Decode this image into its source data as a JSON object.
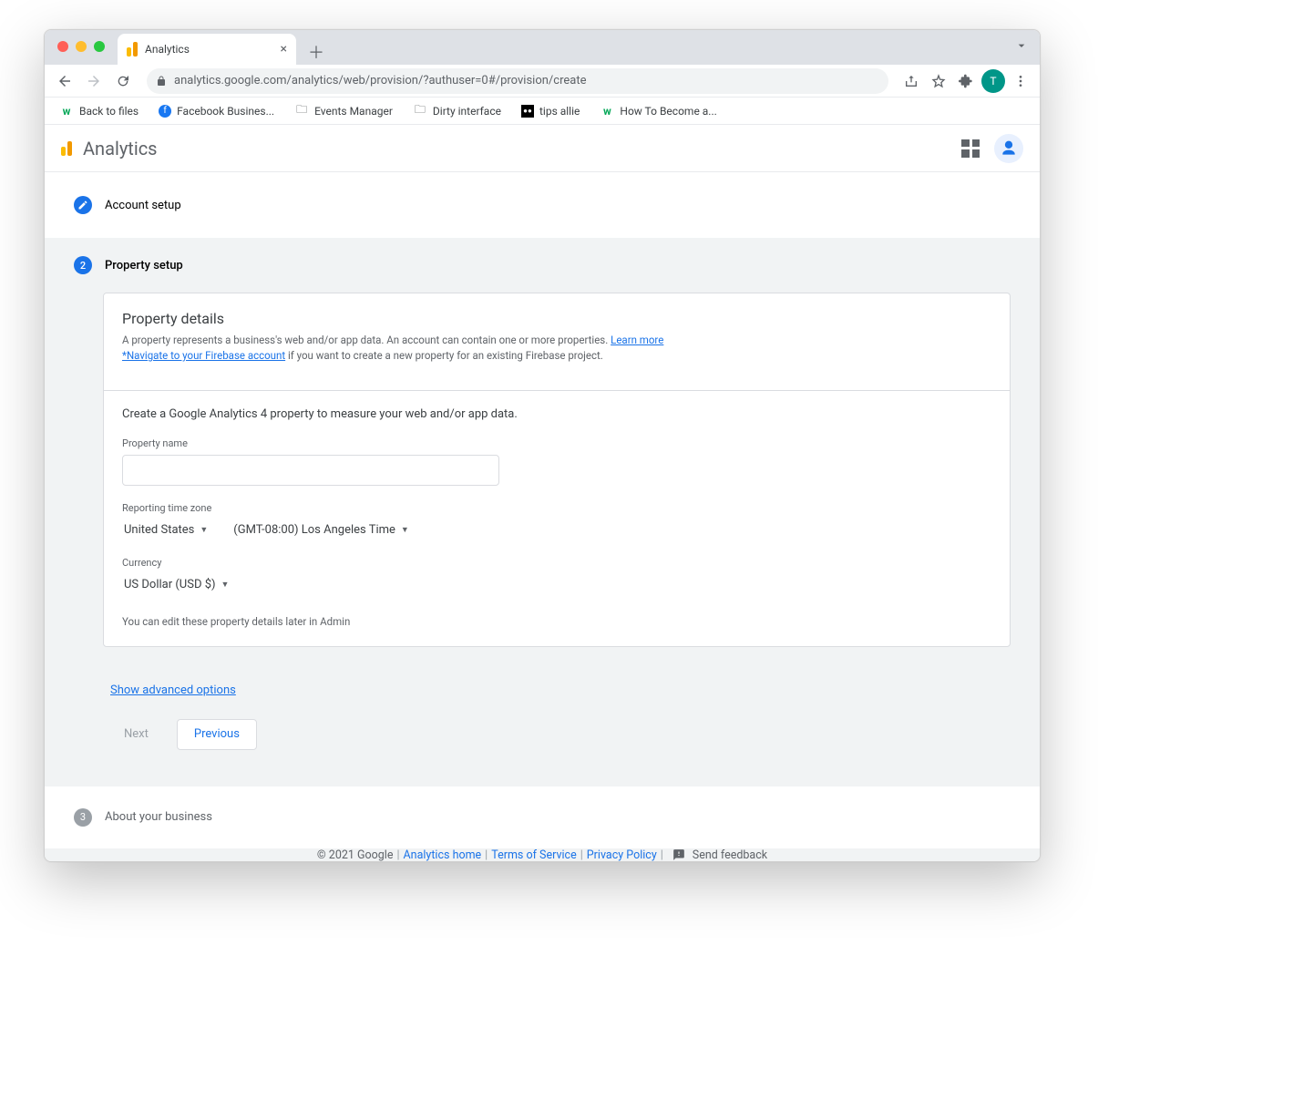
{
  "browser": {
    "tab_title": "Analytics",
    "url": "analytics.google.com/analytics/web/provision/?authuser=0#/provision/create",
    "profile_initial": "T",
    "bookmarks": [
      {
        "label": "Back to files"
      },
      {
        "label": "Facebook Busines..."
      },
      {
        "label": "Events Manager"
      },
      {
        "label": "Dirty interface"
      },
      {
        "label": "tips allie"
      },
      {
        "label": "How To Become a..."
      }
    ]
  },
  "app": {
    "title": "Analytics"
  },
  "steps": {
    "one": {
      "label": "Account setup"
    },
    "two": {
      "number": "2",
      "label": "Property setup"
    },
    "three": {
      "number": "3",
      "label": "About your business"
    }
  },
  "panel": {
    "title": "Property details",
    "hint_a": "A property represents a business's web and/or app data. An account can contain one or more properties. ",
    "learn_more": "Learn more",
    "firebase_link": "*Navigate to your Firebase account",
    "hint_b": " if you want to create a new property for an existing Firebase project.",
    "lead": "Create a Google Analytics 4 property to measure your web and/or app data.",
    "property_name_label": "Property name",
    "property_name_value": "",
    "timezone_label": "Reporting time zone",
    "country_value": "United States",
    "tz_value": "(GMT-08:00) Los Angeles Time",
    "currency_label": "Currency",
    "currency_value": "US Dollar (USD $)",
    "note": "You can edit these property details later in Admin",
    "advanced": "Show advanced options",
    "next": "Next",
    "previous": "Previous"
  },
  "footer": {
    "copyright": "© 2021 Google",
    "analytics_home": "Analytics home",
    "tos": "Terms of Service",
    "privacy": "Privacy Policy",
    "feedback": "Send feedback"
  }
}
